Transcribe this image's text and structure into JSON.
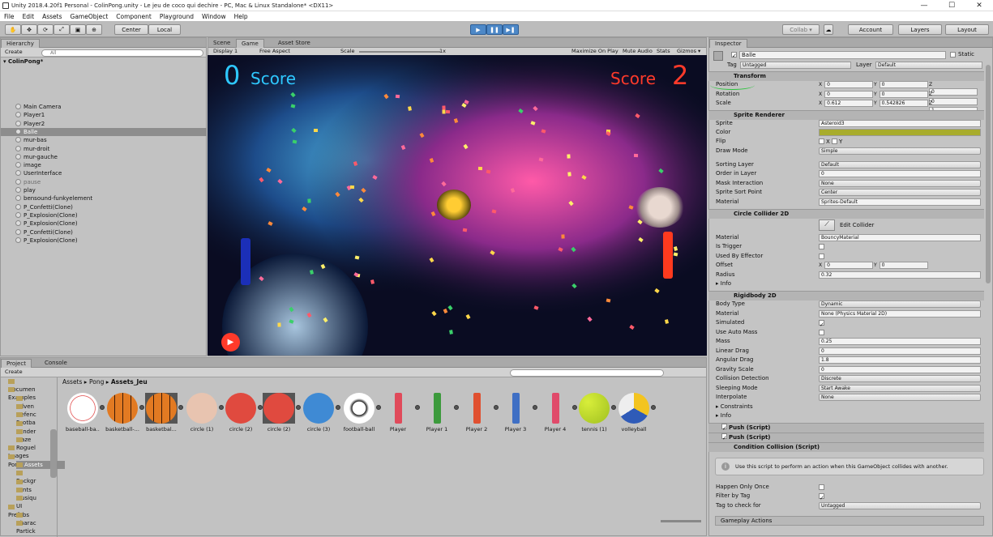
{
  "window": {
    "title": "Unity 2018.4.20f1 Personal - ColinPong.unity - Le jeu de coco qui dechire - PC, Mac & Linux Standalone* <DX11>",
    "min": "—",
    "max": "☐",
    "close": "✕"
  },
  "menu": [
    "File",
    "Edit",
    "Assets",
    "GameObject",
    "Component",
    "Playground",
    "Window",
    "Help"
  ],
  "toolbar": {
    "pivot": "Center",
    "space": "Local",
    "collab": "Collab ▾",
    "account": "Account",
    "layers": "Layers",
    "layout": "Layout"
  },
  "hierarchy": {
    "tab": "Hierarchy",
    "create": "Create",
    "search": "All",
    "scene": "ColinPong*",
    "items": [
      {
        "label": "Main Camera",
        "state": "normal"
      },
      {
        "label": "Player1",
        "state": "normal"
      },
      {
        "label": "Player2",
        "state": "normal"
      },
      {
        "label": "Balle",
        "state": "selected"
      },
      {
        "label": "mur-bas",
        "state": "normal"
      },
      {
        "label": "mur-droit",
        "state": "normal"
      },
      {
        "label": "mur-gauche",
        "state": "normal"
      },
      {
        "label": "image",
        "state": "normal"
      },
      {
        "label": "UserInterface",
        "state": "normal"
      },
      {
        "label": "pause",
        "state": "dim"
      },
      {
        "label": "play",
        "state": "normal"
      },
      {
        "label": "bensound-funkyelement",
        "state": "normal"
      },
      {
        "label": "P_Confetti(Clone)",
        "state": "normal"
      },
      {
        "label": "P_Explosion(Clone)",
        "state": "normal"
      },
      {
        "label": "P_Explosion(Clone)",
        "state": "normal"
      },
      {
        "label": "P_Confetti(Clone)",
        "state": "normal"
      },
      {
        "label": "P_Explosion(Clone)",
        "state": "normal"
      }
    ]
  },
  "center": {
    "tabs": [
      "Scene",
      "Game",
      "Asset Store"
    ],
    "display": "Display 1",
    "aspect": "Free Aspect",
    "scale_label": "Scale",
    "scale_value": "1x",
    "maximize": "Maximize On Play",
    "mute": "Mute Audio",
    "stats": "Stats",
    "gizmos": "Gizmos ▾"
  },
  "game": {
    "left_score": "0",
    "left_label": "Score",
    "right_label": "Score",
    "right_score": "2"
  },
  "project": {
    "tabs": [
      "Project",
      "Console"
    ],
    "create": "Create",
    "breadcrumb": [
      "Assets",
      "Pong",
      "Assets_Jeu"
    ],
    "tree": [
      {
        "label": "Documen",
        "indent": 1
      },
      {
        "label": "Examples",
        "indent": 1
      },
      {
        "label": "Adven",
        "indent": 2
      },
      {
        "label": "Defenc",
        "indent": 2
      },
      {
        "label": "Footba",
        "indent": 2
      },
      {
        "label": "Lander",
        "indent": 2
      },
      {
        "label": "Maze",
        "indent": 2
      },
      {
        "label": "Roguel",
        "indent": 2
      },
      {
        "label": "Images",
        "indent": 1
      },
      {
        "label": "Pong",
        "indent": 1
      },
      {
        "label": "Assets",
        "indent": 2
      },
      {
        "label": "Backgr",
        "indent": 2
      },
      {
        "label": "Fonts",
        "indent": 2
      },
      {
        "label": "Musiqu",
        "indent": 2
      },
      {
        "label": "UI",
        "indent": 2
      },
      {
        "label": "Prefabs",
        "indent": 1
      },
      {
        "label": "Charac",
        "indent": 2
      },
      {
        "label": "Partick",
        "indent": 2
      }
    ],
    "assets": [
      {
        "label": "baseball-ba...",
        "kind": "baseball"
      },
      {
        "label": "basketball-...",
        "kind": "basketball"
      },
      {
        "label": "basketbal...",
        "kind": "basketball"
      },
      {
        "label": "circle (1)",
        "kind": "circle",
        "color": "#e8c4b0"
      },
      {
        "label": "circle (2)",
        "kind": "circle",
        "color": "#e04a3f"
      },
      {
        "label": "circle (2)",
        "kind": "circle",
        "color": "#e04a3f"
      },
      {
        "label": "circle (3)",
        "kind": "circle",
        "color": "#3f8ad4"
      },
      {
        "label": "football-ball",
        "kind": "football"
      },
      {
        "label": "Player",
        "kind": "paddle",
        "color": "#e04a5a"
      },
      {
        "label": "Player 1",
        "kind": "paddle",
        "color": "#3c9a3c"
      },
      {
        "label": "Player 2",
        "kind": "paddle",
        "color": "#e05030"
      },
      {
        "label": "Player 3",
        "kind": "paddle",
        "color": "#3f6fc4"
      },
      {
        "label": "Player 4",
        "kind": "paddle",
        "color": "#e04a6a"
      },
      {
        "label": "tennis (1)",
        "kind": "tennis"
      },
      {
        "label": "volleyball",
        "kind": "volleyball"
      }
    ]
  },
  "inspector": {
    "tab": "Inspector",
    "name": "Balle",
    "static": "Static",
    "tag_label": "Tag",
    "tag": "Untagged",
    "layer_label": "Layer",
    "layer": "Default",
    "transform": {
      "title": "Transform",
      "rows": [
        {
          "label": "Position",
          "x": "0",
          "y": "0",
          "z": "0"
        },
        {
          "label": "Rotation",
          "x": "0",
          "y": "0",
          "z": "0"
        },
        {
          "label": "Scale",
          "x": "0.612",
          "y": "0.542826",
          "z": "1"
        }
      ]
    },
    "sprite": {
      "title": "Sprite Renderer",
      "sprite_label": "Sprite",
      "sprite": "Asteroid3",
      "color_label": "Color",
      "flip_label": "Flip",
      "flip_x": "X",
      "flip_y": "Y",
      "draw_label": "Draw Mode",
      "draw": "Simple",
      "sort_label": "Sorting Layer",
      "sort": "Default",
      "order_label": "Order in Layer",
      "order": "0",
      "mask_label": "Mask Interaction",
      "mask": "None",
      "pivot_label": "Sprite Sort Point",
      "pivot": "Center",
      "mat_label": "Material",
      "mat": "Sprites-Default",
      "tint": "#a8ac2c"
    },
    "collider": {
      "title": "Circle Collider 2D",
      "edit": "Edit Collider",
      "mat_label": "Material",
      "mat": "BouncyMaterial",
      "trigger": "Is Trigger",
      "effector": "Used By Effector",
      "offset_label": "Offset",
      "ox": "0",
      "oy": "0",
      "radius_label": "Radius",
      "radius": "0.32",
      "info": "Info"
    },
    "rigidbody": {
      "title": "Rigidbody 2D",
      "rows": [
        {
          "label": "Body Type",
          "value": "Dynamic",
          "type": "dd"
        },
        {
          "label": "Material",
          "value": "None (Physics Material 2D)",
          "type": "field"
        },
        {
          "label": "Simulated",
          "value": "",
          "type": "check-on"
        },
        {
          "label": "Use Auto Mass",
          "value": "",
          "type": "check"
        },
        {
          "label": "Mass",
          "value": "0.25",
          "type": "field"
        },
        {
          "label": "Linear Drag",
          "value": "0",
          "type": "field"
        },
        {
          "label": "Angular Drag",
          "value": "1.8",
          "type": "field"
        },
        {
          "label": "Gravity Scale",
          "value": "0",
          "type": "field"
        },
        {
          "label": "Collision Detection",
          "value": "Discrete",
          "type": "dd"
        },
        {
          "label": "Sleeping Mode",
          "value": "Start Awake",
          "type": "dd"
        },
        {
          "label": "Interpolate",
          "value": "None",
          "type": "dd"
        }
      ],
      "constraints": "Constraints",
      "info": "Info"
    },
    "push1": "Push (Script)",
    "push2": "Push (Script)",
    "condition": {
      "title": "Condition Collision (Script)",
      "help": "Use this script to perform an action when this GameObject collides with another.",
      "once": "Happen Only Once",
      "filter": "Filter by Tag",
      "tag_label": "Tag to check for",
      "tag": "Untagged",
      "actions": "Gameplay Actions"
    }
  }
}
